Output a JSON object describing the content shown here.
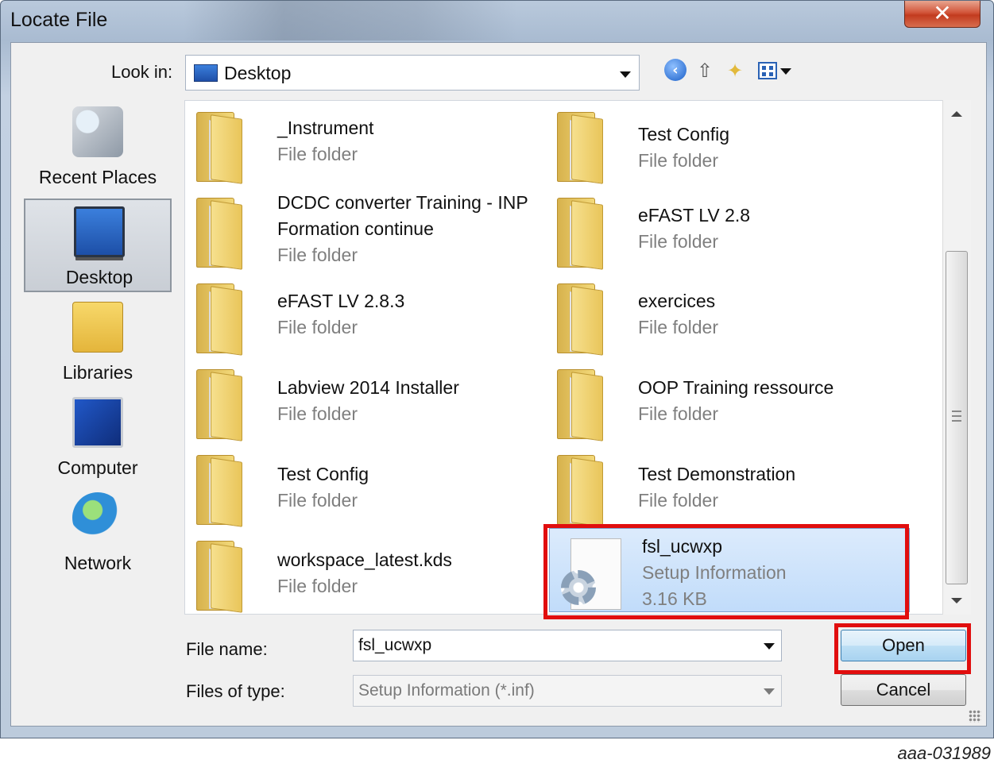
{
  "window": {
    "title": "Locate File",
    "close_glyph": "✕"
  },
  "look_in": {
    "label": "Look in:",
    "value": "Desktop"
  },
  "toolbar": {
    "back_icon": "back-arrow-icon",
    "up_icon": "up-folder-icon",
    "new_folder_icon": "new-folder-icon",
    "views_icon": "views-menu-icon"
  },
  "places": [
    {
      "label": "Recent Places",
      "icon": "recent-places-icon"
    },
    {
      "label": "Desktop",
      "icon": "desktop-icon",
      "selected": true
    },
    {
      "label": "Libraries",
      "icon": "libraries-icon"
    },
    {
      "label": "Computer",
      "icon": "computer-icon"
    },
    {
      "label": "Network",
      "icon": "network-icon"
    }
  ],
  "files": [
    {
      "name": "_Instrument",
      "type": "File folder"
    },
    {
      "name": "Test Config",
      "type": "File folder"
    },
    {
      "name": "DCDC converter Training - INP Formation continue",
      "type": "File folder"
    },
    {
      "name": "eFAST LV 2.8",
      "type": "File folder"
    },
    {
      "name": "eFAST LV 2.8.3",
      "type": "File folder"
    },
    {
      "name": "exercices",
      "type": "File folder"
    },
    {
      "name": "Labview 2014 Installer",
      "type": "File folder"
    },
    {
      "name": "OOP Training ressource",
      "type": "File folder"
    },
    {
      "name": "Test Config",
      "type": "File folder"
    },
    {
      "name": "Test Demonstration",
      "type": "File folder"
    },
    {
      "name": "workspace_latest.kds",
      "type": "File folder"
    },
    {
      "name": "fsl_ucwxp",
      "type": "Setup Information",
      "size": "3.16 KB",
      "selected": true
    }
  ],
  "file_name": {
    "label": "File name:",
    "value": "fsl_ucwxp"
  },
  "file_type": {
    "label": "Files of type:",
    "value": "Setup Information (*.inf)"
  },
  "buttons": {
    "open": "Open",
    "cancel": "Cancel"
  },
  "highlight_color": "#e10e0e",
  "caption": "aaa-031989"
}
